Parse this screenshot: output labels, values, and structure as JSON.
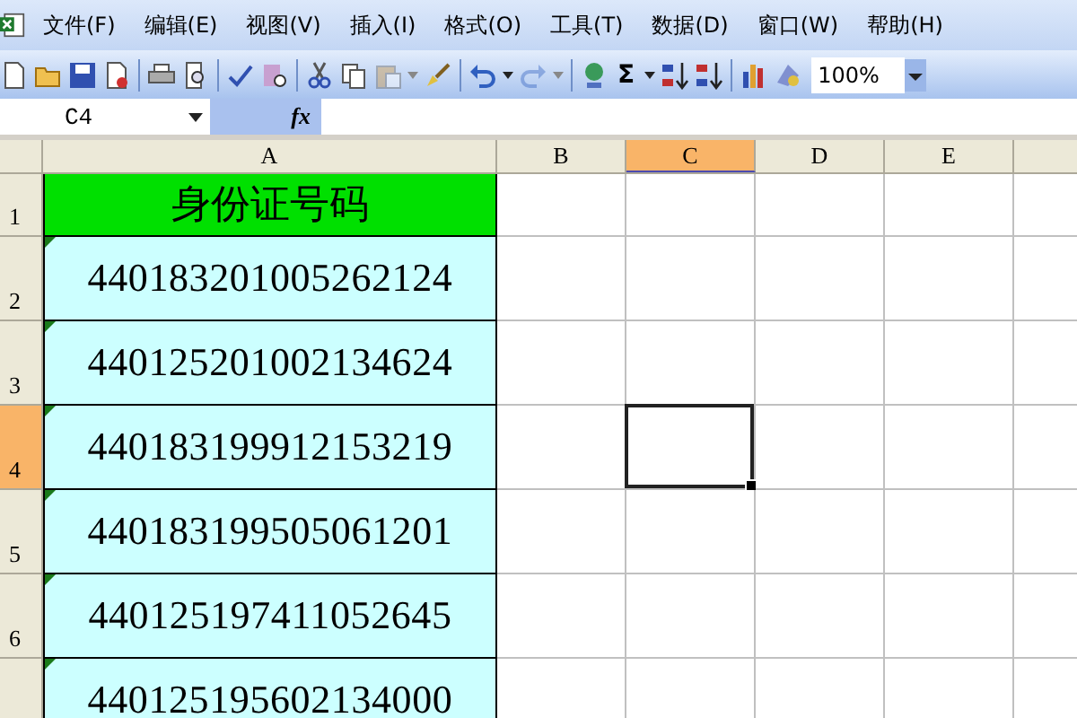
{
  "menu_bar": {
    "items": [
      {
        "label": "文件(F)"
      },
      {
        "label": "编辑(E)"
      },
      {
        "label": "视图(V)"
      },
      {
        "label": "插入(I)"
      },
      {
        "label": "格式(O)"
      },
      {
        "label": "工具(T)"
      },
      {
        "label": "数据(D)"
      },
      {
        "label": "窗口(W)"
      },
      {
        "label": "帮助(H)"
      }
    ]
  },
  "toolbar": {
    "autosum": "Σ",
    "zoom": "100%"
  },
  "formula_bar": {
    "name_box": "C4",
    "function_button": "fx"
  },
  "sheet": {
    "columns": [
      {
        "label": "A",
        "selected": false
      },
      {
        "label": "B",
        "selected": false
      },
      {
        "label": "C",
        "selected": true
      },
      {
        "label": "D",
        "selected": false
      },
      {
        "label": "E",
        "selected": false
      },
      {
        "selected": false
      }
    ],
    "rows": [
      {
        "label": "1",
        "selected": false,
        "cells": [
          {
            "kind": "header",
            "value": "身份证号码"
          }
        ]
      },
      {
        "label": "2",
        "selected": false,
        "cells": [
          {
            "kind": "text_number",
            "value": "440183201005262124"
          }
        ]
      },
      {
        "label": "3",
        "selected": false,
        "cells": [
          {
            "kind": "text_number",
            "value": "440125201002134624"
          }
        ]
      },
      {
        "label": "4",
        "selected": true,
        "cells": [
          {
            "kind": "text_number",
            "value": "440183199912153219"
          }
        ]
      },
      {
        "label": "5",
        "selected": false,
        "cells": [
          {
            "kind": "text_number",
            "value": "440183199505061201"
          }
        ]
      },
      {
        "label": "6",
        "selected": false,
        "cells": [
          {
            "kind": "text_number",
            "value": "440125197411052645"
          }
        ]
      },
      {
        "selected": false,
        "cells": [
          {
            "kind": "text_number",
            "value": "440125195602134000"
          }
        ]
      }
    ]
  }
}
